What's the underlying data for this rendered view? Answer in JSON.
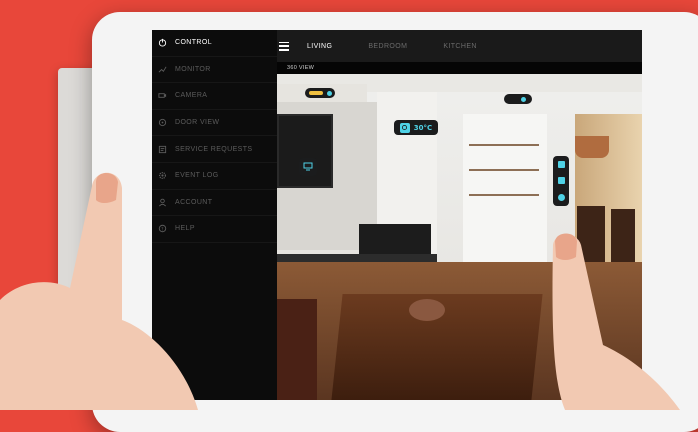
{
  "sidebar": {
    "items": [
      {
        "label": "CONTROL",
        "icon": "power-icon",
        "active": true
      },
      {
        "label": "MONITOR",
        "icon": "chart-icon",
        "active": false
      },
      {
        "label": "CAMERA",
        "icon": "camera-icon",
        "active": false
      },
      {
        "label": "DOOR VIEW",
        "icon": "door-icon",
        "active": false
      },
      {
        "label": "SERVICE REQUESTS",
        "icon": "wrench-icon",
        "active": false
      },
      {
        "label": "EVENT LOG",
        "icon": "gear-icon",
        "active": false
      },
      {
        "label": "ACCOUNT",
        "icon": "user-icon",
        "active": false
      },
      {
        "label": "HELP",
        "icon": "help-icon",
        "active": false
      }
    ]
  },
  "topbar": {
    "tabs": [
      {
        "label": "LIVING",
        "active": true
      },
      {
        "label": "BEDROOM",
        "active": false
      },
      {
        "label": "KITCHEN",
        "active": false
      }
    ]
  },
  "view": {
    "label": "360 VIEW"
  },
  "thermostat": {
    "value": "30°C"
  },
  "colors": {
    "accent": "#4fd2e6",
    "background": "#e8473a",
    "sidebar": "#0c0c0c",
    "light_on": "#f0c040"
  }
}
